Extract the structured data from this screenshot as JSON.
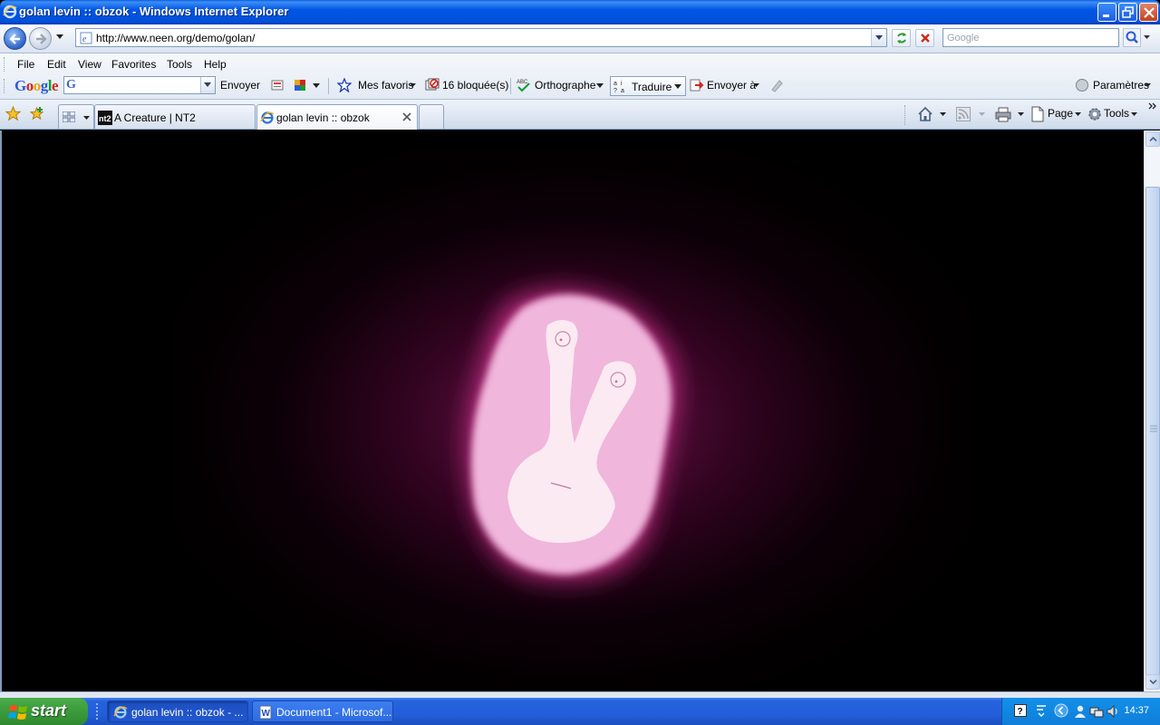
{
  "window": {
    "title": "golan levin :: obzok - Windows Internet Explorer"
  },
  "address": {
    "url": "http://www.neen.org/demo/golan/",
    "search_placeholder": "Google"
  },
  "menu": [
    "File",
    "Edit",
    "View",
    "Favorites",
    "Tools",
    "Help"
  ],
  "google_toolbar": {
    "logo": "Google",
    "search_glyph": "G",
    "send_label": "Envoyer",
    "favorites_label": "Mes favoris",
    "blocked_label": "16 bloquée(s)",
    "spell_label": "Orthographe",
    "translate_label": "Traduire",
    "send_to_label": "Envoyer à",
    "settings_label": "Paramètres"
  },
  "tabs": [
    {
      "label": "A Creature | NT2",
      "icon": "nt2-icon",
      "active": false
    },
    {
      "label": "golan levin :: obzok",
      "icon": "ie-page-icon",
      "active": true
    }
  ],
  "tab_commands": {
    "page_label": "Page",
    "tools_label": "Tools"
  },
  "colors": {
    "titlebar": "#0055e5",
    "creature_body": "#f0b6dc",
    "creature_inner": "#fbeaf2",
    "glow": "#c8288c",
    "start": "#3c9a3c",
    "taskbar": "#245edb"
  },
  "taskbar": {
    "start_label": "start",
    "tasks": [
      {
        "label": "golan levin :: obzok - ...",
        "active": true,
        "icon": "ie-icon"
      },
      {
        "label": "Document1 - Microsof...",
        "active": false,
        "icon": "word-icon"
      }
    ],
    "clock": "14:37"
  }
}
